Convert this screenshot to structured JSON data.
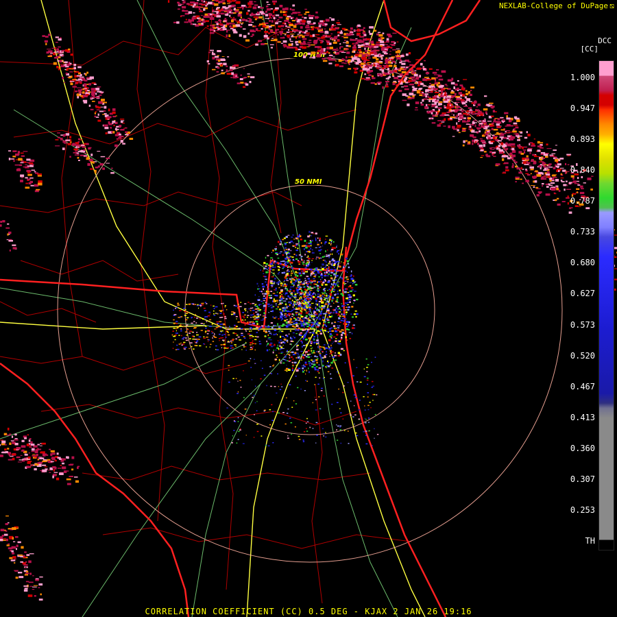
{
  "header": {
    "credit": "NEXLAB-College of DuPage",
    "credit_icon": "logo-icon"
  },
  "legend": {
    "product_code": "DCC",
    "unit": "[CC]",
    "ticks": [
      "1.000",
      "0.947",
      "0.893",
      "0.840",
      "0.787",
      "0.733",
      "0.680",
      "0.627",
      "0.573",
      "0.520",
      "0.467",
      "0.413",
      "0.360",
      "0.307",
      "0.253",
      "TH"
    ],
    "colors": {
      "low_gray": "#8a8a8a",
      "mid_blue": "#1a1aa8",
      "bright_blue": "#2b2bff",
      "lavender": "#9a9aff",
      "green": "#2fd92f",
      "yellow": "#ffff00",
      "orange": "#ff8a00",
      "red": "#d40000",
      "crimson": "#b8104a",
      "pink": "#ff9fcf"
    }
  },
  "map": {
    "range_rings": [
      {
        "label": "50 NMI"
      },
      {
        "label": "100 NMI"
      }
    ],
    "colors": {
      "state_border": "#ff2020",
      "county": "#b00000",
      "highway": "#7fdc7f",
      "interstate": "#ffff40",
      "ring": "#ffb0a0"
    }
  },
  "footer": {
    "caption": "CORRELATION COEFFICIENT (CC) 0.5 DEG - KJAX 2 JAN 26 19:16"
  }
}
